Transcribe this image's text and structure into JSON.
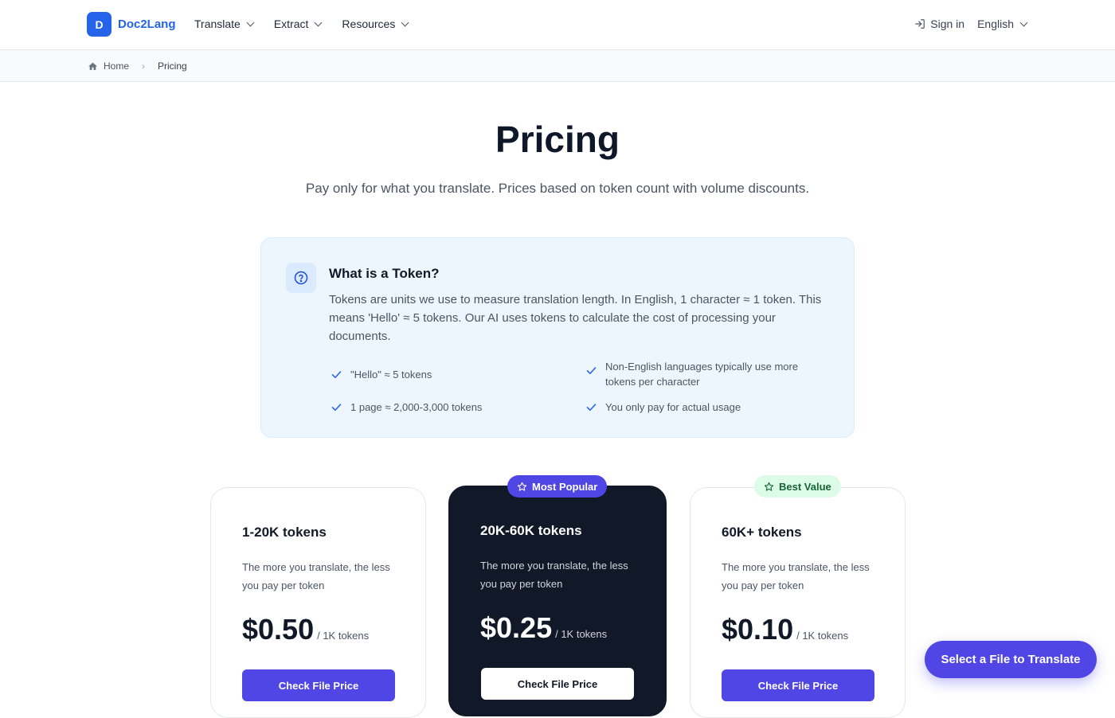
{
  "header": {
    "logo_letter": "D",
    "logo_text": "Doc2Lang",
    "nav": [
      {
        "label": "Translate"
      },
      {
        "label": "Extract"
      },
      {
        "label": "Resources"
      }
    ],
    "sign_in": "Sign in",
    "language": "English"
  },
  "breadcrumb": {
    "home": "Home",
    "current": "Pricing"
  },
  "page": {
    "title": "Pricing",
    "subtitle": "Pay only for what you translate. Prices based on token count with volume discounts."
  },
  "token_info": {
    "title": "What is a Token?",
    "description": "Tokens are units we use to measure translation length. In English, 1 character ≈ 1 token. This means 'Hello' ≈ 5 tokens. Our AI uses tokens to calculate the cost of processing your documents.",
    "features": [
      "\"Hello\" ≈ 5 tokens",
      "Non-English languages typically use more tokens per character",
      "1 page ≈ 2,000-3,000 tokens",
      "You only pay for actual usage"
    ]
  },
  "plans": [
    {
      "title": "1-20K tokens",
      "description": "The more you translate, the less you pay per token",
      "price": "$0.50",
      "unit": "/ 1K tokens",
      "button": "Check File Price"
    },
    {
      "badge": "Most Popular",
      "title": "20K-60K tokens",
      "description": "The more you translate, the less you pay per token",
      "price": "$0.25",
      "unit": "/ 1K tokens",
      "button": "Check File Price"
    },
    {
      "badge": "Best Value",
      "title": "60K+ tokens",
      "description": "The more you translate, the less you pay per token",
      "price": "$0.10",
      "unit": "/ 1K tokens",
      "button": "Check File Price"
    }
  ],
  "fab": {
    "label": "Select a File to Translate"
  },
  "colors": {
    "brand": "#2563eb",
    "accent": "#4f46e5",
    "dark_card": "#111827",
    "best_value_bg": "#dcfce7"
  },
  "icons": [
    "home-icon",
    "sign-in-icon",
    "question-icon",
    "check-icon",
    "star-icon",
    "chevron-down-icon"
  ]
}
